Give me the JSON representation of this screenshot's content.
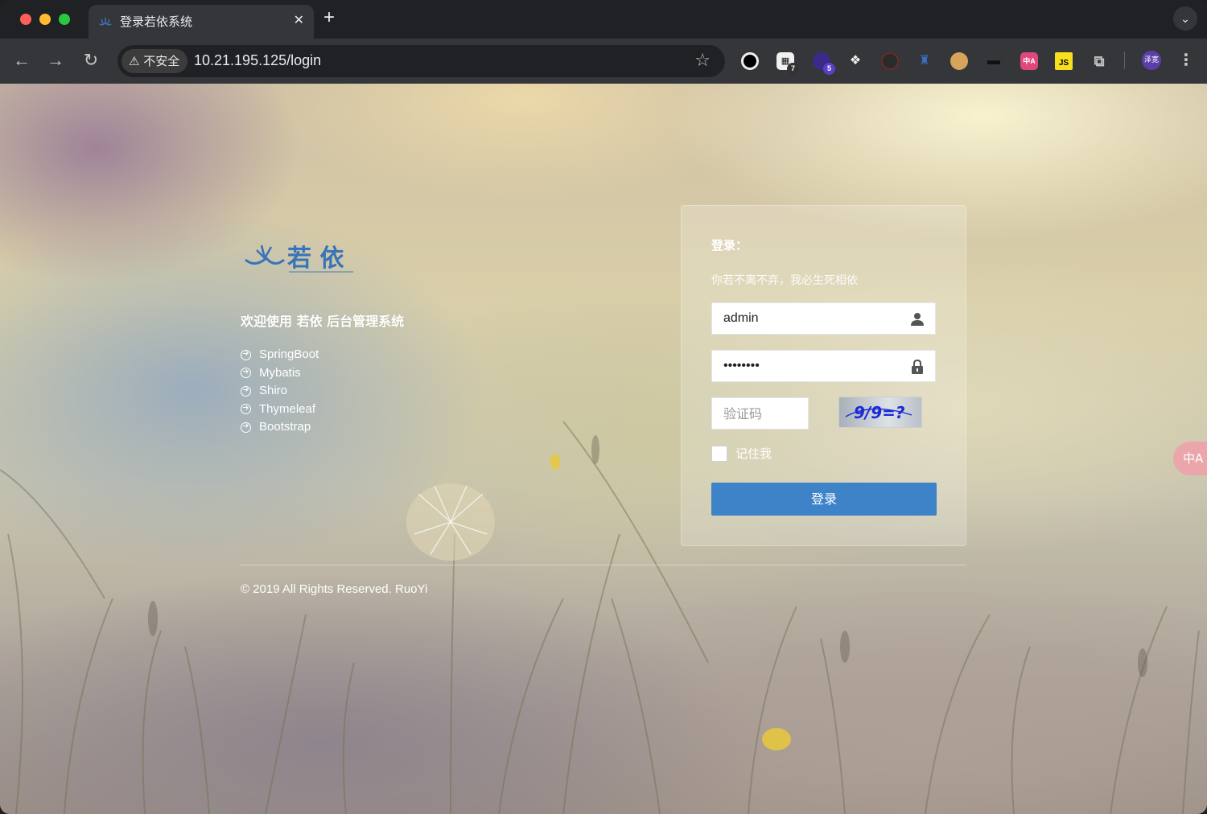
{
  "browser": {
    "tab_title": "登录若依系统",
    "tab_close": "✕",
    "new_tab": "+",
    "insecure_label": "不安全",
    "url": "10.21.195.125/login",
    "extensions": [
      {
        "name": "circle-extension-icon",
        "badge": ""
      },
      {
        "name": "qr-extension-icon",
        "badge": "7"
      },
      {
        "name": "purple-extension-icon",
        "badge": "5"
      },
      {
        "name": "cluster-extension-icon",
        "badge": ""
      },
      {
        "name": "eye-extension-icon",
        "badge": ""
      },
      {
        "name": "person-extension-icon",
        "badge": ""
      },
      {
        "name": "cookie-extension-icon",
        "badge": ""
      },
      {
        "name": "hat-extension-icon",
        "badge": ""
      },
      {
        "name": "translate-extension-icon",
        "badge": "中A"
      },
      {
        "name": "js-extension-icon",
        "badge": "JS"
      },
      {
        "name": "puzzle-extensions-icon",
        "badge": ""
      }
    ],
    "profile_label": "泽宽"
  },
  "page": {
    "logo_text": "若 依",
    "welcome": "欢迎使用 若依 后台管理系统",
    "features": [
      "SpringBoot",
      "Mybatis",
      "Shiro",
      "Thymeleaf",
      "Bootstrap"
    ],
    "copyright": "© 2019 All Rights Reserved. RuoYi"
  },
  "login": {
    "title": "登录：",
    "subtitle": "你若不离不弃，我必生死相依",
    "username_value": "admin",
    "password_value": "admin123",
    "captcha_placeholder": "验证码",
    "captcha_text": "9/9=?",
    "remember_label": "记住我",
    "submit_label": "登录"
  },
  "floating": {
    "translate_label": "中A"
  },
  "colors": {
    "accent": "#3e82c8",
    "logo_blue": "#3a74b8",
    "chrome_bg": "#202124",
    "toolbar_bg": "#35363a"
  }
}
